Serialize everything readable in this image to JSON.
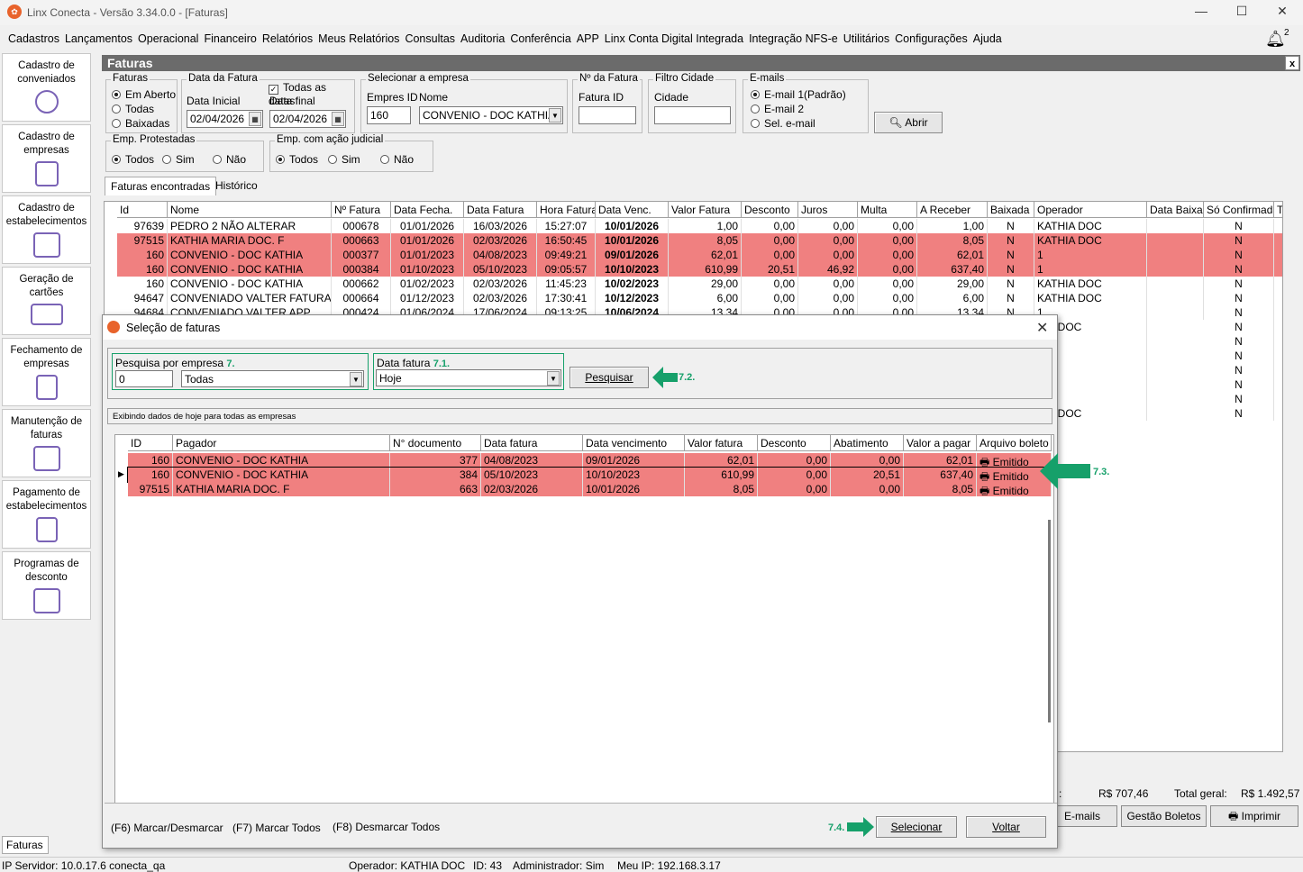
{
  "window": {
    "title": "Linx Conecta - Versão 3.34.0.0 - [Faturas]",
    "min": "—",
    "max": "☐",
    "close": "✕"
  },
  "menu": [
    "Cadastros",
    "Lançamentos",
    "Operacional",
    "Financeiro",
    "Relatórios",
    "Meus Relatórios",
    "Consultas",
    "Auditoria",
    "Conferência",
    "APP",
    "Linx Conta Digital Integrada",
    "Integração NFS-e",
    "Utilitários",
    "Configurações",
    "Ajuda"
  ],
  "notifications": {
    "count": "2"
  },
  "sidebar": [
    {
      "label": "Cadastro de conveniados",
      "icon": "user-icon"
    },
    {
      "label": "Cadastro de empresas",
      "icon": "building-icon"
    },
    {
      "label": "Cadastro de estabelecimentos",
      "icon": "store-icon"
    },
    {
      "label": "Geração de cartões",
      "icon": "card-icon"
    },
    {
      "label": "Fechamento de empresas",
      "icon": "invoice-icon"
    },
    {
      "label": "Manutenção de faturas",
      "icon": "tray-icon"
    },
    {
      "label": "Pagamento de estabelecimentos",
      "icon": "payment-icon"
    },
    {
      "label": "Programas de desconto",
      "icon": "discount-icon"
    }
  ],
  "main": {
    "title": "Faturas",
    "close": "x",
    "faturas": {
      "title": "Faturas",
      "options": [
        "Em Aberto",
        "Todas",
        "Baixadas"
      ],
      "selected": 0
    },
    "data_fatura": {
      "title": "Data da Fatura",
      "todas": "Todas as datas",
      "inicial_label": "Data Inicial",
      "inicial": "02/04/2026",
      "final_label": "Data final",
      "final": "02/04/2026"
    },
    "empresa": {
      "title": "Selecionar a empresa",
      "id_label": "Empres ID",
      "id": "160",
      "nome_label": "Nome",
      "nome": "CONVENIO - DOC KATHIA"
    },
    "nfatura": {
      "title": "Nº da Fatura",
      "label": "Fatura ID",
      "value": ""
    },
    "cidade": {
      "title": "Filtro Cidade",
      "label": "Cidade",
      "value": ""
    },
    "emails": {
      "title": "E-mails",
      "options": [
        "E-mail 1(Padrão)",
        "E-mail 2",
        "Sel. e-mail"
      ],
      "selected": 0
    },
    "abrir": "Abrir",
    "protestadas": {
      "title": "Emp. Protestadas",
      "options": [
        "Todos",
        "Sim",
        "Não"
      ],
      "selected": 0
    },
    "judicial": {
      "title": "Emp. com ação judicial",
      "options": [
        "Todos",
        "Sim",
        "Não"
      ],
      "selected": 0
    },
    "tabs": [
      "Faturas encontradas",
      "Histórico"
    ],
    "columns": [
      "Id",
      "Nome",
      "Nº Fatura",
      "Data Fecha.",
      "Data Fatura",
      "Hora Fatura",
      "Data Venc.",
      "Valor Fatura",
      "Desconto",
      "Juros",
      "Multa",
      "A Receber",
      "Baixada",
      "Operador",
      "Data Baixa",
      "Só Confirmadas",
      "T"
    ],
    "rows": [
      {
        "red": false,
        "c": [
          "97639",
          "PEDRO 2 NÃO ALTERAR",
          "000678",
          "01/01/2026",
          "16/03/2026",
          "15:27:07",
          "10/01/2026",
          "1,00",
          "0,00",
          "0,00",
          "0,00",
          "1,00",
          "N",
          "KATHIA DOC",
          "",
          "N"
        ]
      },
      {
        "red": true,
        "c": [
          "97515",
          "KATHIA MARIA DOC. F",
          "000663",
          "01/01/2026",
          "02/03/2026",
          "16:50:45",
          "10/01/2026",
          "8,05",
          "0,00",
          "0,00",
          "0,00",
          "8,05",
          "N",
          "KATHIA DOC",
          "",
          "N"
        ]
      },
      {
        "red": true,
        "c": [
          "160",
          "CONVENIO - DOC KATHIA",
          "000377",
          "01/01/2023",
          "04/08/2023",
          "09:49:21",
          "09/01/2026",
          "62,01",
          "0,00",
          "0,00",
          "0,00",
          "62,01",
          "N",
          "1",
          "",
          "N"
        ]
      },
      {
        "red": true,
        "c": [
          "160",
          "CONVENIO - DOC KATHIA",
          "000384",
          "01/10/2023",
          "05/10/2023",
          "09:05:57",
          "10/10/2023",
          "610,99",
          "20,51",
          "46,92",
          "0,00",
          "637,40",
          "N",
          "1",
          "",
          "N"
        ]
      },
      {
        "red": false,
        "c": [
          "160",
          "CONVENIO - DOC KATHIA",
          "000662",
          "01/02/2023",
          "02/03/2026",
          "11:45:23",
          "10/02/2023",
          "29,00",
          "0,00",
          "0,00",
          "0,00",
          "29,00",
          "N",
          "KATHIA DOC",
          "",
          "N"
        ]
      },
      {
        "red": false,
        "c": [
          "94647",
          "CONVENIADO VALTER FATURA CA",
          "000664",
          "01/12/2023",
          "02/03/2026",
          "17:30:41",
          "10/12/2023",
          "6,00",
          "0,00",
          "0,00",
          "0,00",
          "6,00",
          "N",
          "KATHIA DOC",
          "",
          "N"
        ]
      },
      {
        "red": false,
        "c": [
          "94684",
          "CONVENIADO VALTER APP",
          "000424",
          "01/06/2024",
          "17/06/2024",
          "09:13:25",
          "10/06/2024",
          "13,34",
          "0,00",
          "0,00",
          "0,00",
          "13,34",
          "N",
          "1",
          "",
          "N"
        ]
      }
    ],
    "hidden_rows": [
      {
        "op": "HIA DOC",
        "sc": "N"
      },
      {
        "op": "",
        "sc": "N"
      },
      {
        "op": "",
        "sc": "N"
      },
      {
        "op": "",
        "sc": "N"
      },
      {
        "op": "",
        "sc": "N"
      },
      {
        "op": "",
        "sc": "N"
      },
      {
        "op": "HIA DOC",
        "sc": "N"
      }
    ],
    "totals": {
      "left_label": ":",
      "left_value": "R$  707,46",
      "total_label": "Total geral:",
      "total_value": "R$  1.492,57"
    },
    "buttons": {
      "emails": "E-mails",
      "gestao": "Gestão Boletos",
      "imprimir": "Imprimir"
    },
    "bottom_tab": "Faturas"
  },
  "status": {
    "servidor": "IP Servidor: 10.0.17.6 conecta_qa",
    "operador": "Operador: KATHIA DOC",
    "id": "ID: 43",
    "admin": "Administrador: Sim",
    "ip": "Meu IP: 192.168.3.17"
  },
  "dialog": {
    "title": "Seleção de faturas",
    "close": "✕",
    "pesquisa": {
      "title": "Pesquisa por empresa",
      "step": "7.",
      "id": "0",
      "empresa": "Todas"
    },
    "data": {
      "title": "Data fatura",
      "step": "7.1.",
      "value": "Hoje"
    },
    "pesquisar": "Pesquisar",
    "step_pesquisar": "7.2.",
    "info": "Exibindo dados de hoje para todas as empresas",
    "columns": [
      "ID",
      "Pagador",
      "N° documento",
      "Data fatura",
      "Data vencimento",
      "Valor fatura",
      "Desconto",
      "Abatimento",
      "Valor a pagar",
      "Arquivo boleto"
    ],
    "rows": [
      {
        "c": [
          "160",
          "CONVENIO - DOC KATHIA",
          "377",
          "04/08/2023",
          "09/01/2026",
          "62,01",
          "0,00",
          "0,00",
          "62,01",
          "Emitido"
        ],
        "sel": false
      },
      {
        "c": [
          "160",
          "CONVENIO - DOC KATHIA",
          "384",
          "05/10/2023",
          "10/10/2023",
          "610,99",
          "0,00",
          "20,51",
          "637,40",
          "Emitido"
        ],
        "sel": true
      },
      {
        "c": [
          "97515",
          "KATHIA MARIA DOC. F",
          "663",
          "02/03/2026",
          "10/01/2026",
          "8,05",
          "0,00",
          "0,00",
          "8,05",
          "Emitido"
        ],
        "sel": false
      }
    ],
    "step_rows": "7.3.",
    "shortcuts": [
      "(F6) Marcar/Desmarcar",
      "(F7) Marcar Todos",
      "(F8) Desmarcar Todos"
    ],
    "step_selecionar": "7.4.",
    "selecionar": "Selecionar",
    "voltar": "Voltar"
  },
  "colors": {
    "red_row": "#f08080",
    "accent_green": "#16a06a",
    "header_gray": "#6b6b6b"
  }
}
